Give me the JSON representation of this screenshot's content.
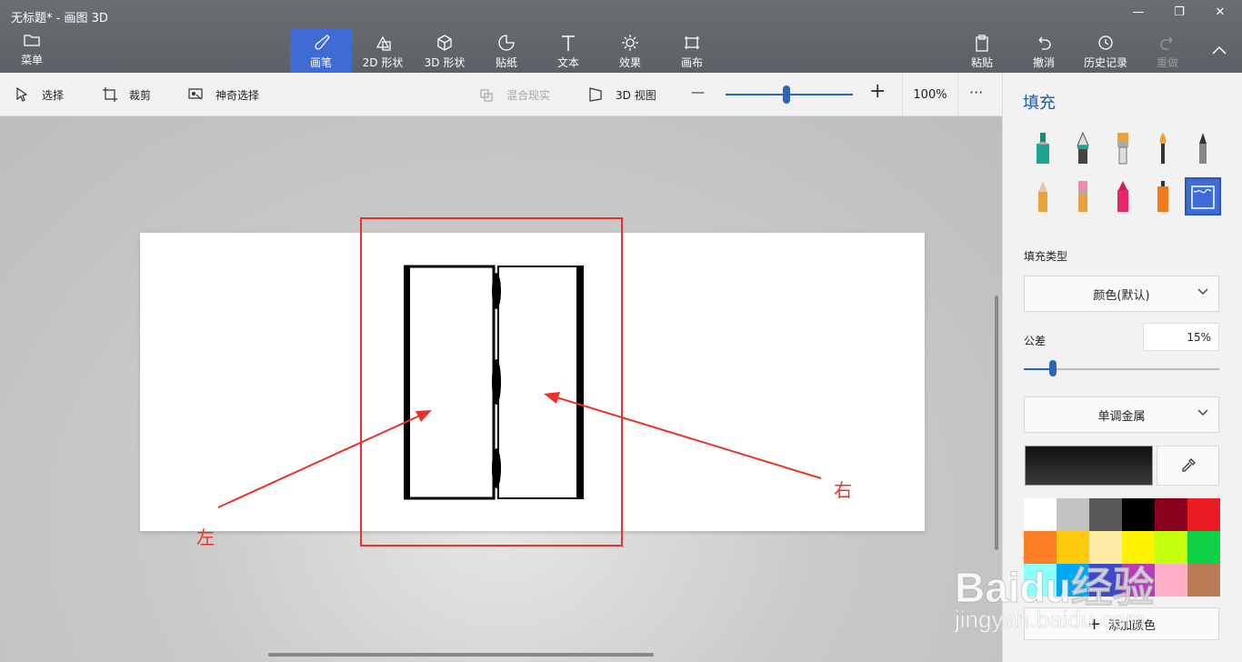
{
  "window": {
    "title": "无标题* - 画图 3D"
  },
  "ribbon": {
    "menu": "菜单",
    "tools": [
      {
        "label": "画笔",
        "icon": "brush-icon",
        "active": true
      },
      {
        "label": "2D 形状",
        "icon": "shapes-2d-icon"
      },
      {
        "label": "3D 形状",
        "icon": "cube-icon"
      },
      {
        "label": "贴纸",
        "icon": "sticker-icon"
      },
      {
        "label": "文本",
        "icon": "text-icon"
      },
      {
        "label": "效果",
        "icon": "effects-icon"
      },
      {
        "label": "画布",
        "icon": "canvas-icon"
      }
    ],
    "right": [
      {
        "label": "粘贴",
        "icon": "paste-icon"
      },
      {
        "label": "撤消",
        "icon": "undo-icon"
      },
      {
        "label": "历史记录",
        "icon": "history-icon"
      },
      {
        "label": "重做",
        "icon": "redo-icon",
        "disabled": true
      }
    ]
  },
  "toolbar": {
    "select": "选择",
    "crop": "裁剪",
    "magic_select": "神奇选择",
    "mixed_reality": "混合现实",
    "view_3d": "3D 视图",
    "zoom_out": "—",
    "zoom_in": "+",
    "zoom": "100%",
    "more": "···",
    "zoom_level": 0.48
  },
  "canvas": {
    "annotation_left": "左",
    "annotation_right": "右",
    "annotation_color": "#e8322b"
  },
  "panel": {
    "title": "填充",
    "fill_type_label": "填充类型",
    "fill_type": "颜色(默认)",
    "tolerance_label": "公差",
    "tolerance": "15%",
    "tolerance_value": 0.15,
    "material": "单调金属",
    "add_color": "添加颜色",
    "palette": [
      "#ffffff",
      "#c3c3c3",
      "#585858",
      "#000000",
      "#88001b",
      "#ec1c24",
      "#ff7f27",
      "#ffc90e",
      "#fdeca6",
      "#fff200",
      "#c4ff0e",
      "#0ed145",
      "#8cfffb",
      "#00a8f3",
      "#3f48cc",
      "#b83dba",
      "#ffaec8",
      "#b97a56"
    ]
  },
  "watermark": {
    "text": "Baidu经验",
    "url_text": "jingyan.baidu.com"
  }
}
